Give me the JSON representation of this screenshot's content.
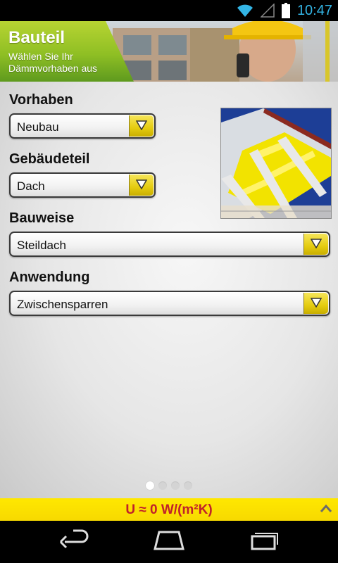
{
  "status_bar": {
    "time": "10:47",
    "icons": [
      "wifi-icon",
      "signal-icon",
      "battery-icon"
    ]
  },
  "header": {
    "title": "Bauteil",
    "subtitle": "Wählen Sie Ihr Dämmvorhaben aus"
  },
  "form": {
    "vorhaben": {
      "label": "Vorhaben",
      "value": "Neubau"
    },
    "gebaeudeteil": {
      "label": "Gebäudeteil",
      "value": "Dach"
    },
    "bauweise": {
      "label": "Bauweise",
      "value": "Steildach"
    },
    "anwendung": {
      "label": "Anwendung",
      "value": "Zwischensparren"
    }
  },
  "pager": {
    "count": 4,
    "active_index": 0
  },
  "u_value": {
    "text": "U ≈ 0 W/(m²K)"
  },
  "colors": {
    "accent_yellow": "#f7d900",
    "header_green": "#8fbf24",
    "u_value_red": "#c0202a",
    "status_blue": "#33b5e5"
  },
  "nav": {
    "icons": [
      "back-icon",
      "home-icon",
      "recent-apps-icon"
    ]
  }
}
